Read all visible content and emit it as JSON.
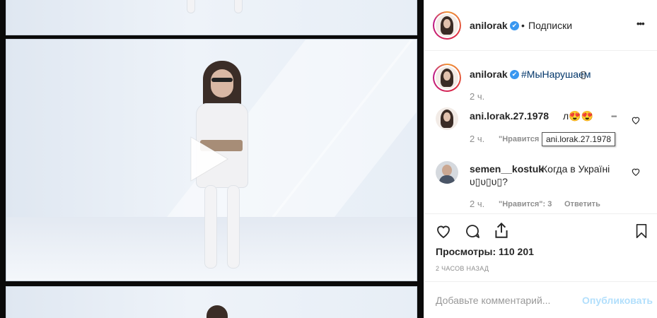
{
  "post": {
    "username": "anilorak",
    "follow_separator": "•",
    "follow_label": "Подписки",
    "more_label": "•••"
  },
  "caption": {
    "username": "anilorak",
    "hashtag": "#МыНарушаем",
    "emoji": "▯",
    "time": "2 ч."
  },
  "comments": [
    {
      "username": "ani.lorak.27.1978",
      "text": "л😍😍",
      "time": "2 ч.",
      "likes_label": "\"Нравится",
      "more": "•••"
    },
    {
      "username": "semen__kostuk",
      "text": "Когда в Україні",
      "text2": "υ▯υ▯υ▯?",
      "time": "2 ч.",
      "likes_label": "\"Нравится\": 3",
      "reply_label": "Ответить"
    }
  ],
  "tooltip": "ani.lorak.27.1978",
  "stats": {
    "views_label": "Просмотры: 110 201",
    "timestamp": "2 ЧАСОВ НАЗАД"
  },
  "composer": {
    "placeholder": "Добавьте комментарий...",
    "publish_label": "Опубликовать"
  },
  "colors": {
    "verified": "#3897f0",
    "link": "#003569",
    "muted": "#8e8e8e",
    "publish_disabled": "#b2dffc"
  },
  "icons": [
    "verified-badge-icon",
    "more-icon",
    "heart-icon",
    "comment-icon",
    "share-icon",
    "bookmark-icon",
    "play-icon"
  ]
}
